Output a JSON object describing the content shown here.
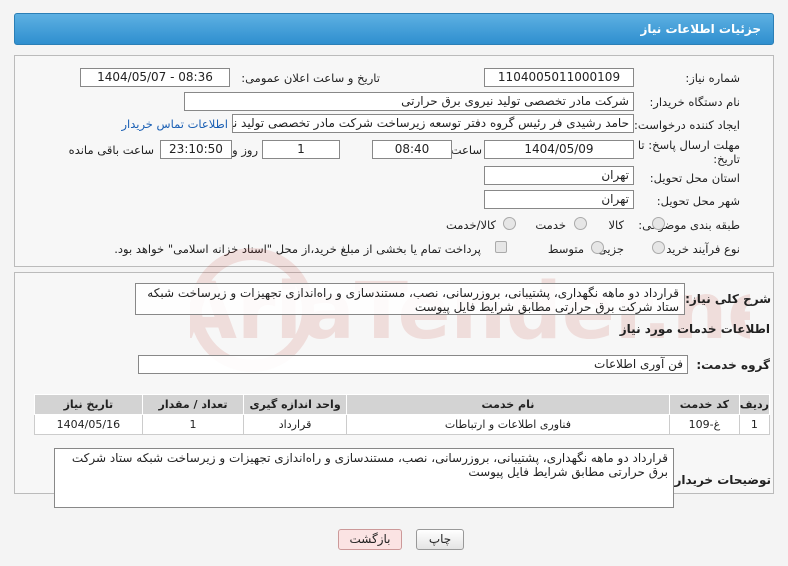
{
  "header": {
    "title": "جزئیات اطلاعات نیاز"
  },
  "form": {
    "need_number_label": "شماره نیاز:",
    "need_number": "1104005011000109",
    "announce_label": "تاریخ و ساعت اعلان عمومی:",
    "announce_value": "1404/05/07 - 08:36",
    "buyer_org_label": "نام دستگاه خریدار:",
    "buyer_org": "شرکت مادر تخصصی تولید نیروی برق حرارتی",
    "creator_label": "ایجاد کننده درخواست:",
    "creator": "حامد رشیدی فر رئیس گروه دفتر توسعه زیرساخت شرکت مادر تخصصی تولید نیر",
    "contact_link": "اطلاعات تماس خریدار",
    "deadline_label_1": "مهلت ارسال پاسخ: تا",
    "deadline_label_2": "تاریخ:",
    "deadline_date": "1404/05/09",
    "time_label": "ساعت",
    "deadline_time": "08:40",
    "days_value": "1",
    "days_label": "روز و",
    "remaining_time": "23:10:50",
    "remaining_label": "ساعت باقی مانده",
    "province_label": "استان محل تحویل:",
    "province": "تهران",
    "city_label": "شهر محل تحویل:",
    "city": "تهران",
    "category_label": "طبقه بندی موضوعی:",
    "category_options": [
      "کالا",
      "خدمت",
      "کالا/خدمت"
    ],
    "process_label": "نوع فرآیند خرید :",
    "process_options": [
      "جزیی",
      "متوسط"
    ],
    "payment_note": "پرداخت تمام یا بخشی از مبلغ خرید،از محل \"اسناد خزانه اسلامی\" خواهد بود."
  },
  "summary": {
    "label": "شرح کلی نیاز:",
    "text": "قرارداد دو ماهه نگهداری، پشتیبانی، بروزرسانی، نصب، مستندسازی و راه‌اندازی تجهیزات و زیرساخت شبکه ستاد شرکت   برق حرارتی مطابق شرایط فایل پیوست"
  },
  "services": {
    "section_title": "اطلاعات خدمات مورد نیاز",
    "group_label": "گروه خدمت:",
    "group_value": "فن آوری اطلاعات",
    "columns": [
      "ردیف",
      "کد خدمت",
      "نام خدمت",
      "واحد اندازه گیری",
      "تعداد / مقدار",
      "تاریخ نیاز"
    ],
    "rows": [
      [
        "1",
        "غ-109",
        "فناوری اطلاعات و ارتباطات",
        "قرارداد",
        "1",
        "1404/05/16"
      ]
    ]
  },
  "buyer_notes": {
    "label": "توضیحات خریدار:",
    "text": "قرارداد دو ماهه نگهداری، پشتیبانی، بروزرسانی، نصب، مستندسازی و راه‌اندازی تجهیزات و زیرساخت شبکه ستاد شرکت برق حرارتی مطابق شرایط فایل پیوست"
  },
  "buttons": {
    "print": "چاپ",
    "back": "بازگشت"
  },
  "watermark": {
    "text": "AriaTender.neT"
  }
}
